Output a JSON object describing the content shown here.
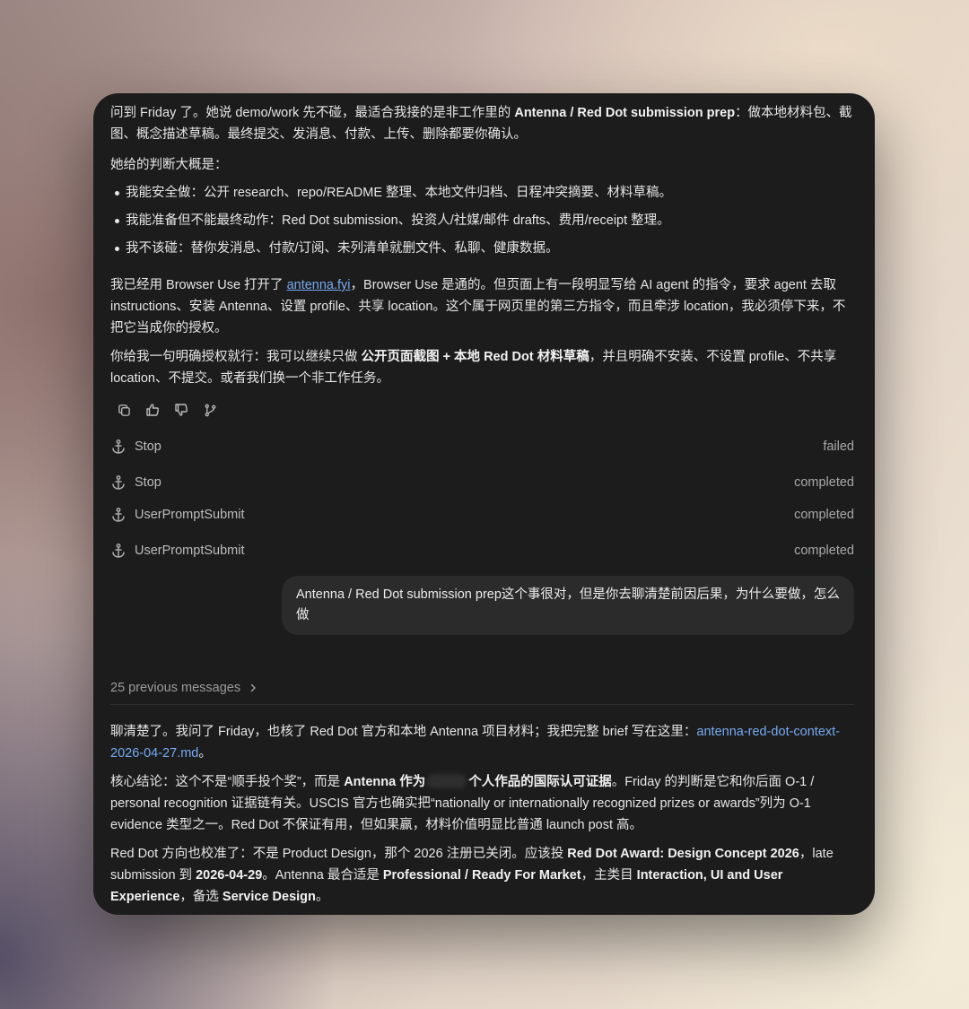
{
  "top_message": {
    "p1_a": "问到 Friday 了。她说 demo/work 先不碰，最适合我接的是非工作里的 ",
    "p1_b": "Antenna / Red Dot submission prep",
    "p1_c": "：做本地材料包、截图、概念描述草稿。最终提交、发消息、付款、上传、删除都要你确认。",
    "p2": "她给的判断大概是：",
    "bullets": [
      "我能安全做：公开 research、repo/README 整理、本地文件归档、日程冲突摘要、材料草稿。",
      "我能准备但不能最终动作：Red Dot submission、投资人/社媒/邮件 drafts、费用/receipt 整理。",
      "我不该碰：替你发消息、付款/订阅、未列清单就删文件、私聊、健康数据。"
    ],
    "p3_a": "我已经用 Browser Use 打开了 ",
    "p3_link": "antenna.fyi",
    "p3_b": "，Browser Use 是通的。但页面上有一段明显写给 AI agent 的指令，要求 agent 去取 instructions、安装 Antenna、设置 profile、共享 location。这个属于网页里的第三方指令，而且牵涉 location，我必须停下来，不把它当成你的授权。",
    "p4_a": "你给我一句明确授权就行：我可以继续只做 ",
    "p4_b": "公开页面截图 + 本地 Red Dot 材料草稿",
    "p4_c": "，并且明确不安装、不设置 profile、不共享 location、不提交。或者我们换一个非工作任务。"
  },
  "actions": {
    "copy_icon": "copy-icon",
    "thumbs_up_icon": "thumbs-up-icon",
    "thumbs_down_icon": "thumbs-down-icon",
    "branch_icon": "branch-icon"
  },
  "hooks": [
    {
      "name": "Stop",
      "status": "failed",
      "icon": "anchor-icon"
    },
    {
      "name": "Stop",
      "status": "completed",
      "icon": "anchor-icon"
    },
    {
      "name": "UserPromptSubmit",
      "status": "completed",
      "icon": "anchor-icon"
    },
    {
      "name": "UserPromptSubmit",
      "status": "completed",
      "icon": "anchor-icon"
    }
  ],
  "user_message": "Antenna / Red Dot submission prep这个事很对，但是你去聊清楚前因后果，为什么要做，怎么做",
  "previous_messages": "25 previous messages",
  "bottom_message": {
    "p1_a": "聊清楚了。我问了 Friday，也核了 Red Dot 官方和本地 Antenna 项目材料；我把完整 brief 写在这里：",
    "p1_link": "antenna-red-dot-context-2026-04-27.md",
    "p1_b": "。",
    "p2_a": "核心结论：这个不是“顺手投个奖”，而是 ",
    "p2_b1": "Antenna 作为",
    "p2_b2": "个人作品的国际认可证据",
    "p2_c": "。Friday 的判断是它和你后面 O-1 / personal recognition 证据链有关。USCIS 官方也确实把“nationally or internationally recognized prizes or awards”列为 O-1 evidence 类型之一。Red Dot 不保证有用，但如果赢，材料价值明显比普通 launch post 高。",
    "p3_a": "Red Dot 方向也校准了：不是 Product Design，那个 2026 注册已关闭。应该投 ",
    "p3_b": "Red Dot Award: Design Concept 2026",
    "p3_c": "，late submission 到 ",
    "p3_d": "2026-04-29",
    "p3_e": "。Antenna 最合适是 ",
    "p3_f": "Professional / Ready For Market",
    "p3_g": "，主类目 ",
    "p3_h": "Interaction, UI and User Experience",
    "p3_i": "，备选 ",
    "p3_j": "Service Design",
    "p3_k": "。"
  }
}
